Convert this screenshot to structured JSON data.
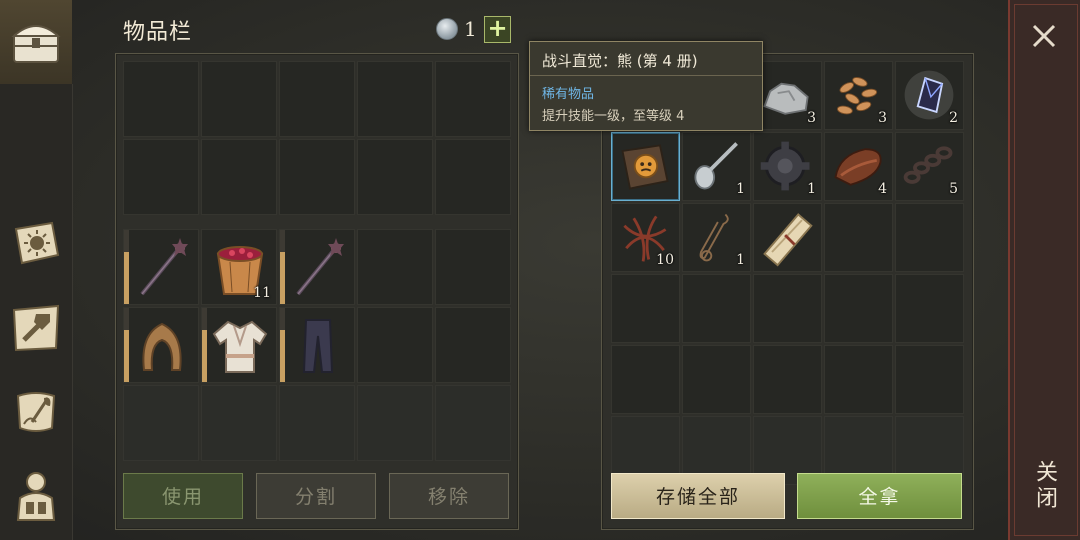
{
  "header": {
    "title": "物品栏",
    "currency_count": "1",
    "plus_label": "+"
  },
  "sidebar": {
    "items": [
      {
        "icon": "chest-icon"
      },
      {
        "icon": "sun-book-icon"
      },
      {
        "icon": "crafting-hammer-icon"
      },
      {
        "icon": "quest-scroll-icon"
      },
      {
        "icon": "character-icon"
      }
    ]
  },
  "inventory": {
    "top_slots": 10,
    "items": [
      {
        "icon": "mace-icon",
        "qty": "",
        "durability": 0.7
      },
      {
        "icon": "berry-bucket-icon",
        "qty": "11"
      },
      {
        "icon": "mace-icon",
        "qty": "",
        "durability": 0.7
      },
      {
        "icon": "hood-icon",
        "qty": "",
        "durability": 0.7
      },
      {
        "icon": "shirt-icon",
        "qty": "",
        "durability": 0.7
      },
      {
        "icon": "pants-icon",
        "qty": "",
        "durability": 0.7
      }
    ],
    "buttons": {
      "use": "使用",
      "split": "分割",
      "remove": "移除"
    }
  },
  "storage": {
    "items": [
      {
        "icon": "stone-icon",
        "qty": "3"
      },
      {
        "icon": "seeds-icon",
        "qty": "3"
      },
      {
        "icon": "crystal-icon",
        "qty": "2"
      },
      {
        "icon": "skill-book-icon",
        "qty": ""
      },
      {
        "icon": "spoon-icon",
        "qty": "1"
      },
      {
        "icon": "gear-part-icon",
        "qty": "1"
      },
      {
        "icon": "leather-icon",
        "qty": "4"
      },
      {
        "icon": "chain-icon",
        "qty": "5"
      },
      {
        "icon": "roots-icon",
        "qty": "10"
      },
      {
        "icon": "rope-icon",
        "qty": "1"
      },
      {
        "icon": "papyrus-scroll-icon",
        "qty": ""
      }
    ],
    "buttons": {
      "store_all": "存储全部",
      "take_all": "全拿"
    }
  },
  "tooltip": {
    "title": "战斗直觉：熊 (第 4 册)",
    "rarity": "稀有物品",
    "description": "提升技能一级，至等级 4"
  },
  "close": {
    "label": "关闭"
  },
  "colors": {
    "accent_green": "#8fb05a",
    "store_beige": "#ddd0ac",
    "rarity_blue": "#6fb6e6",
    "durability": "#c8a062"
  }
}
